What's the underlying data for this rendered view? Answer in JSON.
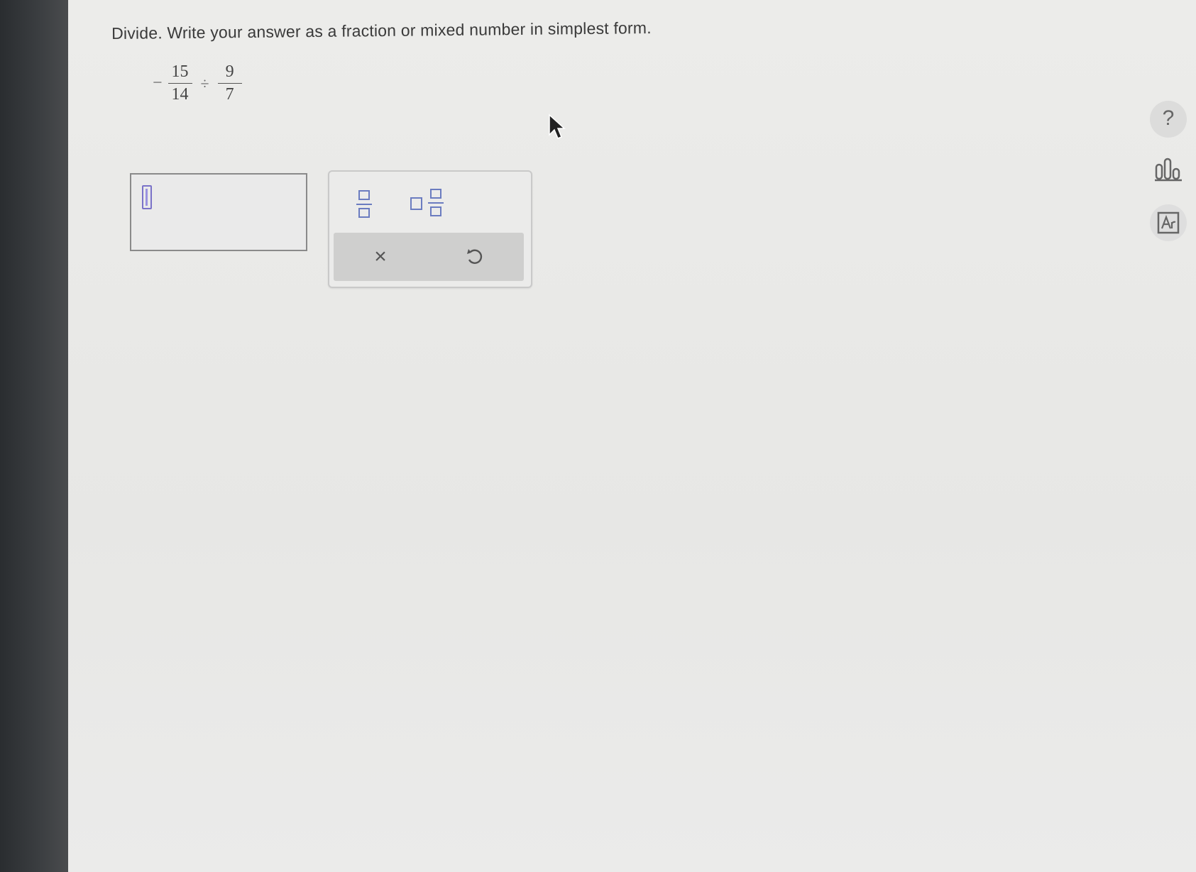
{
  "instructions": "Divide. Write your answer as a fraction or mixed number in simplest form.",
  "problem": {
    "sign": "−",
    "fraction1": {
      "numerator": "15",
      "denominator": "14"
    },
    "operator": "÷",
    "fraction2": {
      "numerator": "9",
      "denominator": "7"
    }
  },
  "answer": {
    "value": ""
  },
  "toolbox": {
    "fraction_icon": "fraction-template-icon",
    "mixed_icon": "mixed-number-template-icon",
    "clear_label": "×",
    "undo_icon": "undo-icon"
  },
  "sidebar": {
    "help_label": "?",
    "stats_icon": "bar-chart-icon",
    "text_icon": "text-reader-icon"
  },
  "colors": {
    "accent": "#6b7cc0",
    "caret": "#7a72c8"
  }
}
